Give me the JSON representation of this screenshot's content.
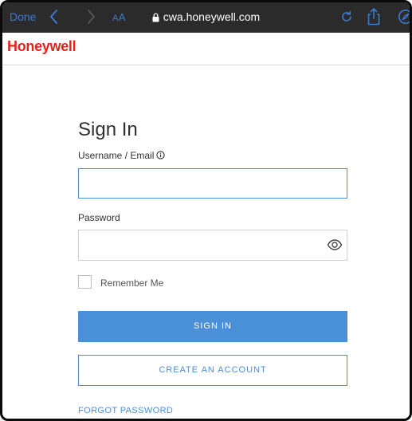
{
  "browser": {
    "done_label": "Done",
    "aa_small": "A",
    "aa_big": "A",
    "url": "cwa.honeywell.com"
  },
  "brand": {
    "name": "Honeywell"
  },
  "signin": {
    "title": "Sign In",
    "username_label": "Username / Email",
    "username_value": "",
    "password_label": "Password",
    "password_value": "",
    "remember_label": "Remember Me",
    "sign_in_button": "SIGN IN",
    "create_account_button": "CREATE AN ACCOUNT",
    "forgot_password_link": "FORGOT PASSWORD"
  },
  "icons": {
    "back": "chevron-left-icon",
    "forward": "chevron-right-icon",
    "lock": "lock-icon",
    "reload": "reload-icon",
    "share": "share-icon",
    "compass": "compass-icon",
    "info": "info-icon",
    "eye": "eye-icon"
  },
  "colors": {
    "accent": "#4a90d9",
    "brand_red": "#e2231a",
    "browser_bar": "#2b2b2b"
  }
}
